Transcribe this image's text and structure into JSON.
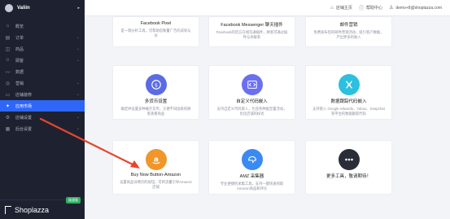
{
  "sidebar": {
    "store_name": "Valiin",
    "items": [
      {
        "label": "概览",
        "icon": "home-icon",
        "glyph": "⌂",
        "has_children": false,
        "active": false
      },
      {
        "label": "订单",
        "icon": "order-icon",
        "glyph": "▤",
        "has_children": true,
        "active": false
      },
      {
        "label": "商品",
        "icon": "product-icon",
        "glyph": "◫",
        "has_children": true,
        "active": false
      },
      {
        "label": "顾客",
        "icon": "customer-icon",
        "glyph": "☺",
        "has_children": true,
        "active": false
      },
      {
        "label": "数据",
        "icon": "chart-icon",
        "glyph": "〰",
        "has_children": false,
        "active": false
      },
      {
        "label": "营销",
        "icon": "marketing-icon",
        "glyph": "◎",
        "has_children": true,
        "active": false
      },
      {
        "label": "店铺装修",
        "icon": "theme-icon",
        "glyph": "▭",
        "has_children": true,
        "active": false
      },
      {
        "label": "应用市场",
        "icon": "apps-icon",
        "glyph": "✦",
        "has_children": false,
        "active": true
      },
      {
        "label": "店铺设置",
        "icon": "settings-icon",
        "glyph": "⚙",
        "has_children": true,
        "active": false
      },
      {
        "label": "后台设置",
        "icon": "admin-icon",
        "glyph": "▦",
        "has_children": true,
        "active": false
      }
    ],
    "footer_brand": "Shoplazza",
    "badge": "极速版"
  },
  "header": {
    "store_home": "店铺主页",
    "help": "帮助中心",
    "user": "demo+8@shoplazza.com"
  },
  "cards": [
    {
      "title": "Facebook Pixel",
      "desc": "是一款分析工具，可帮助您衡量广告的成效与访",
      "icon": null,
      "color": null
    },
    {
      "title": "Facebook Messenger 聊天插件",
      "desc": "Facebook的官方在线沟通插件，顾客可通过插件与你联系",
      "icon": null,
      "color": null
    },
    {
      "title": "邮件营销",
      "desc": "免费发布您的邮件营销活动，吸引客户数据，产出更多的收入",
      "icon": null,
      "color": null
    },
    {
      "title": "多货币设置",
      "desc": "确定并设置多种展示货币，方便不同国家的顾客查看商品",
      "icon": "currency-icon",
      "color": "#5b6be6"
    },
    {
      "title": "自定义代码嵌入",
      "desc": "支持自定义代码嵌入，包含各种类型置活动，优化店铺的样式",
      "icon": "code-icon",
      "color": "#6b6ff0"
    },
    {
      "title": "数据跟踪代码嵌入",
      "desc": "支持嵌入 Google Adwords、Yahoo、Snapchat 等平台的数据跟踪代码",
      "icon": "tracking-icon",
      "color": "#2cbfe0"
    },
    {
      "title": "Buy Now Button-Amazon",
      "desc": "设置商品详情页的按钮，可将流量引导Amazon店铺",
      "icon": "amazon-icon",
      "color": "#f0962a"
    },
    {
      "title": "AMZ 采集器",
      "desc": "专业便捷的采集工具，支持一键快速抓取Amazon商品和评论",
      "icon": "collector-icon",
      "color": "#3a8af2"
    },
    {
      "title": "更多工具，敬请期待！",
      "desc": "",
      "icon": "more-icon",
      "color": "#2a2d38"
    }
  ]
}
